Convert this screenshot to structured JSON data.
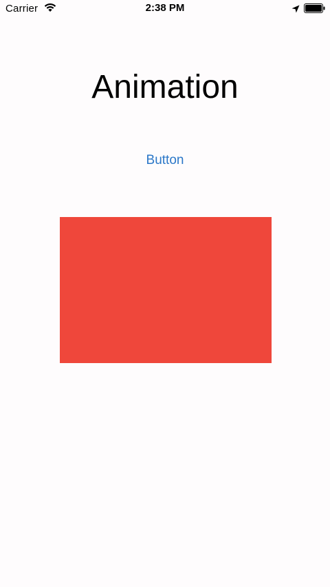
{
  "status_bar": {
    "carrier": "Carrier",
    "time": "2:38 PM",
    "icons": [
      "wifi-icon",
      "location-icon",
      "battery-icon"
    ]
  },
  "main": {
    "title": "Animation",
    "button_label": "Button",
    "animated_view_color": "#ef473b"
  },
  "colors": {
    "background": "#fefcfd",
    "button_tint": "#2b77c8"
  }
}
